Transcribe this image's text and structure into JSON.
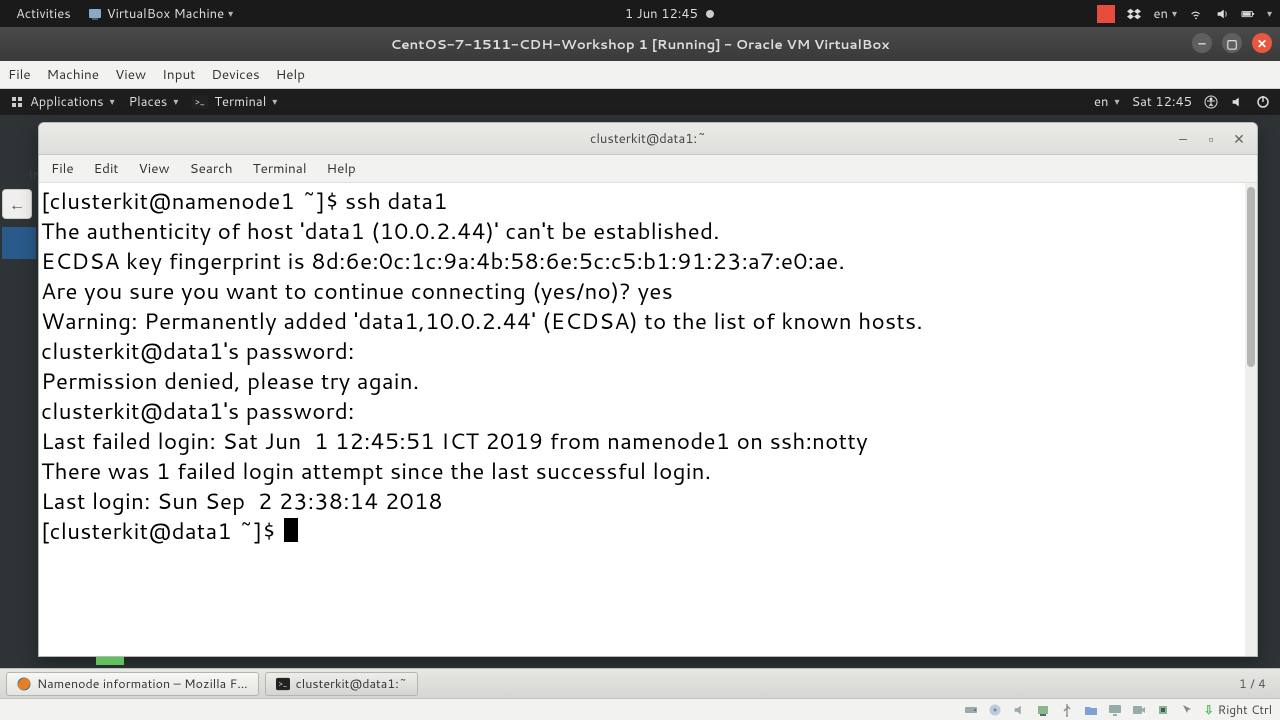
{
  "host_topbar": {
    "activities": "Activities",
    "app_menu": "VirtualBox Machine",
    "clock": "1 Jun  12:45",
    "lang": "en"
  },
  "vbox": {
    "title": "CentOS-7-1511-CDH-Workshop 1 [Running] - Oracle VM VirtualBox",
    "menus": [
      "File",
      "Machine",
      "View",
      "Input",
      "Devices",
      "Help"
    ],
    "host_key": "Right Ctrl"
  },
  "guest_topbar": {
    "applications": "Applications",
    "places": "Places",
    "terminal_menu": "Terminal",
    "lang": "en",
    "clock": "Sat 12:45"
  },
  "peek": {
    "label": "In"
  },
  "terminal": {
    "title": "clusterkit@data1:~",
    "menus": [
      "File",
      "Edit",
      "View",
      "Search",
      "Terminal",
      "Help"
    ],
    "lines": [
      "[clusterkit@namenode1 ~]$ ssh data1",
      "The authenticity of host 'data1 (10.0.2.44)' can't be established.",
      "ECDSA key fingerprint is 8d:6e:0c:1c:9a:4b:58:6e:5c:c5:b1:91:23:a7:e0:ae.",
      "Are you sure you want to continue connecting (yes/no)? yes",
      "Warning: Permanently added 'data1,10.0.2.44' (ECDSA) to the list of known hosts.",
      "clusterkit@data1's password: ",
      "Permission denied, please try again.",
      "clusterkit@data1's password: ",
      "Last failed login: Sat Jun  1 12:45:51 ICT 2019 from namenode1 on ssh:notty",
      "There was 1 failed login attempt since the last successful login.",
      "Last login: Sun Sep  2 23:38:14 2018"
    ],
    "prompt": "[clusterkit@data1 ~]$ "
  },
  "guest_taskbar": {
    "firefox_task": "Namenode information – Mozilla F...",
    "terminal_task": "clusterkit@data1:~",
    "workspace": "1 / 4"
  }
}
